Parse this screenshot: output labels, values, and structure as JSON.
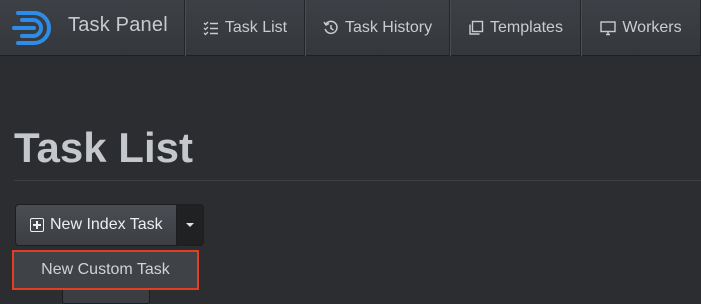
{
  "brand": {
    "name": "Task Panel"
  },
  "nav": [
    {
      "label": "Task List",
      "icon": "list-check-icon"
    },
    {
      "label": "Task History",
      "icon": "history-icon"
    },
    {
      "label": "Templates",
      "icon": "copy-icon"
    },
    {
      "label": "Workers",
      "icon": "monitor-icon"
    }
  ],
  "page": {
    "title": "Task List"
  },
  "toolbar": {
    "new_index_task_label": "New Index Task",
    "dropdown_items": [
      "New Custom Task"
    ]
  },
  "colors": {
    "background": "#2b2d30",
    "navbar": "#3a3e42",
    "highlight_border": "#e23e22",
    "logo_blue": "#2f8be8"
  }
}
